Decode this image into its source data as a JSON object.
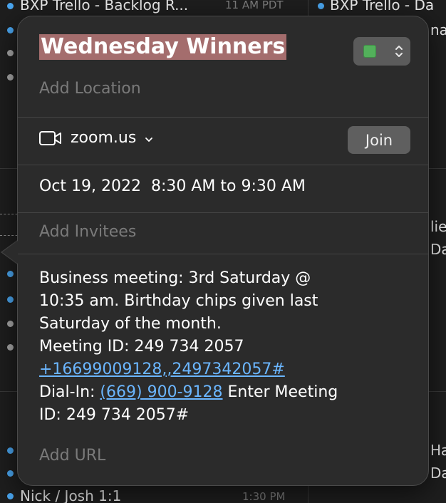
{
  "background": {
    "events": [
      {
        "title": "BXP Trello - Backlog R...",
        "time": "11 AM PDT",
        "dot": "blue"
      },
      {
        "title": "BXP Trello - Da",
        "dot": "blue"
      },
      {
        "title": "nae"
      },
      {
        "title": "lie"
      },
      {
        "title": "Da"
      },
      {
        "title": "Nick / Josh 1:1",
        "time": "1:30 PM"
      },
      {
        "title": "Ha"
      },
      {
        "title": "Da"
      }
    ]
  },
  "popover": {
    "title": "Wednesday Winners",
    "calendar_color": "#53b05b",
    "location_placeholder": "Add Location",
    "conference": {
      "label": "zoom.us",
      "join_label": "Join"
    },
    "datetime": "Oct 19, 2022  8:30 AM to 9:30 AM",
    "invitees_placeholder": "Add Invitees",
    "notes": {
      "line1": "Business meeting: 3rd Saturday @",
      "line2": "10:35 am. Birthday chips given last",
      "line3": "Saturday of the month.",
      "line4": "Meeting ID: 249 734 2057",
      "link1": "+16699009128,,2497342057#",
      "dialin_prefix": "Dial-In: ",
      "link2": "(669) 900-9128",
      "dialin_suffix": " Enter Meeting",
      "line7": "ID: 249 734 2057#"
    },
    "url_placeholder": "Add URL"
  }
}
